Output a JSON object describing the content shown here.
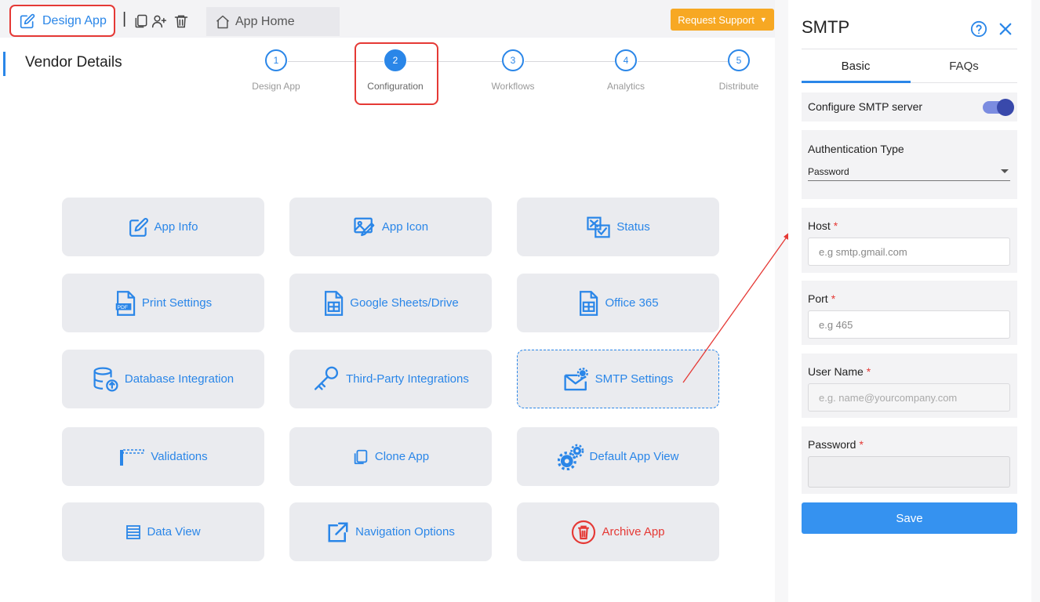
{
  "toolbar": {
    "design_app_label": "Design App",
    "separator": "|",
    "copy_icon": "copy-icon",
    "add_user_icon": "add-user-icon",
    "trash_icon": "trash-icon",
    "app_home_label": "App Home",
    "request_support_label": "Request Support"
  },
  "page": {
    "title": "Vendor Details"
  },
  "stepper": {
    "steps": [
      {
        "num": "1",
        "label": "Design App"
      },
      {
        "num": "2",
        "label": "Configuration",
        "active": true
      },
      {
        "num": "3",
        "label": "Workflows"
      },
      {
        "num": "4",
        "label": "Analytics"
      },
      {
        "num": "5",
        "label": "Distribute"
      }
    ]
  },
  "tiles": [
    {
      "label": "App Info",
      "icon": "edit-icon"
    },
    {
      "label": "App Icon",
      "icon": "image-edit-icon"
    },
    {
      "label": "Status",
      "icon": "status-icon"
    },
    {
      "label": "Print Settings",
      "icon": "pdf-icon"
    },
    {
      "label": "Google Sheets/Drive",
      "icon": "sheet-icon"
    },
    {
      "label": "Office 365",
      "icon": "sheet-icon"
    },
    {
      "label": "Database Integration",
      "icon": "database-icon"
    },
    {
      "label": "Third-Party Integrations",
      "icon": "key-icon"
    },
    {
      "label": "SMTP Settings",
      "icon": "mail-gear-icon",
      "selected": true
    },
    {
      "label": "Validations",
      "icon": "barrier-icon"
    },
    {
      "label": "Clone App",
      "icon": "copy-icon"
    },
    {
      "label": "Default App View",
      "icon": "gears-icon"
    },
    {
      "label": "Data View",
      "icon": "list-icon"
    },
    {
      "label": "Navigation Options",
      "icon": "external-link-icon"
    },
    {
      "label": "Archive App",
      "icon": "archive-icon",
      "danger": true
    }
  ],
  "panel": {
    "title": "SMTP",
    "help_icon": "help-icon",
    "close_icon": "close-icon",
    "tabs": [
      {
        "label": "Basic",
        "active": true
      },
      {
        "label": "FAQs"
      }
    ],
    "configure_label": "Configure SMTP server",
    "configure_enabled": true,
    "auth_label": "Authentication Type",
    "auth_value": "Password",
    "host_label": "Host",
    "host_placeholder": "e.g smtp.gmail.com",
    "port_label": "Port",
    "port_placeholder": "e.g 465",
    "user_label": "User Name",
    "user_placeholder": "e.g. name@yourcompany.com",
    "password_label": "Password",
    "required_mark": "*",
    "save_label": "Save"
  },
  "colors": {
    "accent": "#2a86e8",
    "highlight": "#e53935",
    "support": "#f7a823",
    "tile_bg": "#eaebef",
    "toggle": "#3949ab"
  }
}
